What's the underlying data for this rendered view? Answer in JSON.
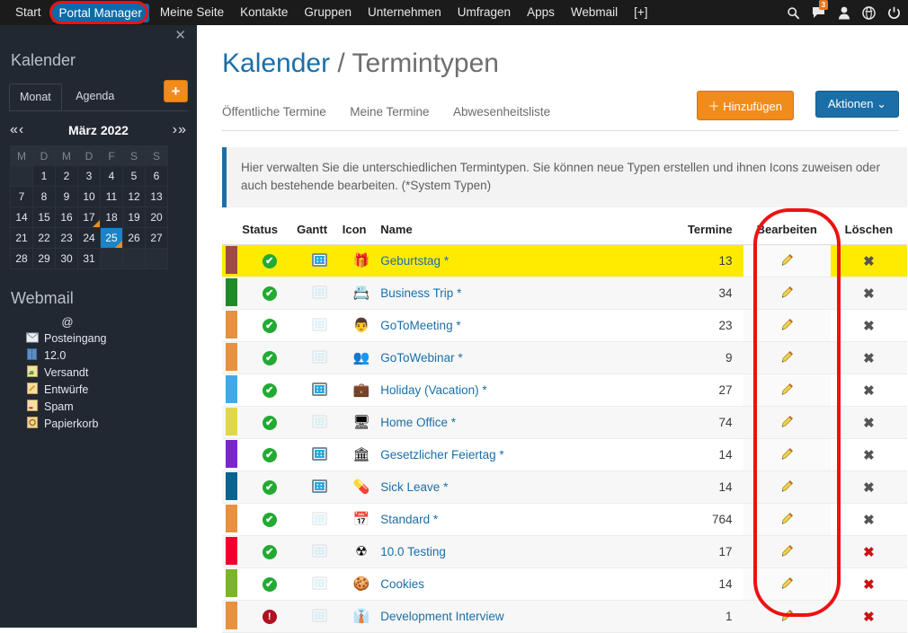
{
  "topnav": {
    "items": [
      {
        "label": "Start",
        "active": false
      },
      {
        "label": "Portal Manager",
        "active": true
      },
      {
        "label": "Meine Seite",
        "active": false
      },
      {
        "label": "Kontakte",
        "active": false
      },
      {
        "label": "Gruppen",
        "active": false
      },
      {
        "label": "Unternehmen",
        "active": false
      },
      {
        "label": "Umfragen",
        "active": false
      },
      {
        "label": "Apps",
        "active": false
      },
      {
        "label": "Webmail",
        "active": false
      },
      {
        "label": "[+]",
        "active": false
      }
    ],
    "icons": [
      {
        "name": "search-icon",
        "glyph": "⌕"
      },
      {
        "name": "messages-icon",
        "glyph": "▬",
        "badge": "3"
      },
      {
        "name": "user-icon",
        "glyph": "♟"
      },
      {
        "name": "globe-icon",
        "glyph": "●"
      },
      {
        "name": "power-icon",
        "glyph": "⏻"
      }
    ],
    "accent_active": "#0b6ba8",
    "badge_color": "#e8761b"
  },
  "sidebar": {
    "close_label": "✕",
    "calendar_title": "Kalender",
    "tabs": [
      {
        "label": "Monat",
        "active": true
      },
      {
        "label": "Agenda",
        "active": false
      }
    ],
    "add_button_label": "+",
    "nav_prev": "«‹",
    "nav_next": "›»",
    "month_label": "März 2022",
    "weekdays": [
      "M",
      "D",
      "M",
      "D",
      "F",
      "S",
      "S"
    ],
    "weeks": [
      [
        "",
        "1",
        "2",
        "3",
        "4",
        "5",
        "6"
      ],
      [
        "7",
        "8",
        "9",
        "10",
        "11",
        "12",
        "13"
      ],
      [
        "14",
        "15",
        "16",
        "17",
        "18",
        "19",
        "20"
      ],
      [
        "21",
        "22",
        "23",
        "24",
        "25",
        "26",
        "27"
      ],
      [
        "28",
        "29",
        "30",
        "31",
        "",
        "",
        ""
      ]
    ],
    "selected_day": "25",
    "event_days": [
      "17",
      "25"
    ],
    "webmail_title": "Webmail",
    "webmail_account": "@",
    "webmail_folders": [
      {
        "label": "Posteingang",
        "icon": "inbox-icon",
        "glyph": "✉"
      },
      {
        "label": "12.0",
        "icon": "folder-icon",
        "glyph": "▮"
      },
      {
        "label": "Versandt",
        "icon": "sent-icon",
        "glyph": "▭"
      },
      {
        "label": "Entwürfe",
        "icon": "drafts-icon",
        "glyph": "✎"
      },
      {
        "label": "Spam",
        "icon": "spam-icon",
        "glyph": "▭"
      },
      {
        "label": "Papierkorb",
        "icon": "trash-icon",
        "glyph": "♻"
      }
    ]
  },
  "main": {
    "title_primary": "Kalender",
    "title_secondary": " / Termintypen",
    "subtabs": [
      {
        "label": "Öffentliche Termine"
      },
      {
        "label": "Meine Termine"
      },
      {
        "label": "Abwesenheitsliste"
      }
    ],
    "add_button": "＋ Hinzufügen",
    "actions_button": "Aktionen ⌄",
    "info_text": "Hier verwalten Sie die unterschiedlichen Termintypen. Sie können neue Typen erstellen und ihnen Icons zuweisen oder auch bestehende bearbeiten. (*System Typen)",
    "table": {
      "headers": [
        "",
        "Status",
        "Gantt",
        "Icon",
        "Name",
        "Termine",
        "Bearbeiten",
        "Löschen"
      ],
      "rows": [
        {
          "color": "#a04a42",
          "status": "active",
          "gantt": true,
          "icon_glyph": "🎁",
          "icon_name": "gift-icon",
          "name": "Geburtstag *",
          "termine": "13",
          "deletable": false,
          "highlight": true
        },
        {
          "color": "#1f8a28",
          "status": "active",
          "gantt": false,
          "icon_glyph": "📇",
          "icon_name": "id-card-icon",
          "name": "Business Trip *",
          "termine": "34",
          "deletable": false,
          "highlight": false
        },
        {
          "color": "#e8913f",
          "status": "active",
          "gantt": false,
          "icon_glyph": "👨",
          "icon_name": "person-icon",
          "name": "GoToMeeting *",
          "termine": "23",
          "deletable": false,
          "highlight": false
        },
        {
          "color": "#e8913f",
          "status": "active",
          "gantt": false,
          "icon_glyph": "👥",
          "icon_name": "people-icon",
          "name": "GoToWebinar *",
          "termine": "9",
          "deletable": false,
          "highlight": false
        },
        {
          "color": "#3cabe8",
          "status": "active",
          "gantt": true,
          "icon_glyph": "💼",
          "icon_name": "briefcase-icon",
          "name": "Holiday (Vacation) *",
          "termine": "27",
          "deletable": false,
          "highlight": false
        },
        {
          "color": "#e0d84a",
          "status": "active",
          "gantt": false,
          "icon_glyph": "🖥",
          "icon_name": "computer-icon",
          "name": "Home Office *",
          "termine": "74",
          "deletable": false,
          "highlight": false
        },
        {
          "color": "#7b26c9",
          "status": "active",
          "gantt": true,
          "icon_glyph": "🏛",
          "icon_name": "bank-icon",
          "name": "Gesetzlicher Feiertag *",
          "termine": "14",
          "deletable": false,
          "highlight": false
        },
        {
          "color": "#0a6490",
          "status": "active",
          "gantt": true,
          "icon_glyph": "💊",
          "icon_name": "pill-icon",
          "name": "Sick Leave *",
          "termine": "14",
          "deletable": false,
          "highlight": false
        },
        {
          "color": "#e8913f",
          "status": "active",
          "gantt": false,
          "icon_glyph": "📅",
          "icon_name": "calendar-icon",
          "name": "Standard *",
          "termine": "764",
          "deletable": false,
          "highlight": false
        },
        {
          "color": "#f0002e",
          "status": "active",
          "gantt": false,
          "icon_glyph": "☢",
          "icon_name": "radiation-icon",
          "name": "10.0 Testing",
          "termine": "17",
          "deletable": true,
          "highlight": false
        },
        {
          "color": "#7cb42a",
          "status": "active",
          "gantt": false,
          "icon_glyph": "🍪",
          "icon_name": "cookie-icon",
          "name": "Cookies",
          "termine": "14",
          "deletable": true,
          "highlight": false
        },
        {
          "color": "#e8913f",
          "status": "off",
          "gantt": false,
          "icon_glyph": "👔",
          "icon_name": "businessman-icon",
          "name": "Development Interview",
          "termine": "1",
          "deletable": true,
          "highlight": false
        }
      ]
    },
    "edit_icon_glyph": "✎",
    "delete_icon_glyph": "✖",
    "status_active_glyph": "✔",
    "status_off_glyph": "!"
  },
  "annotations": {
    "portal_manager_highlight_color": "#ee1111",
    "edit_column_highlight_color": "#ee1111"
  }
}
